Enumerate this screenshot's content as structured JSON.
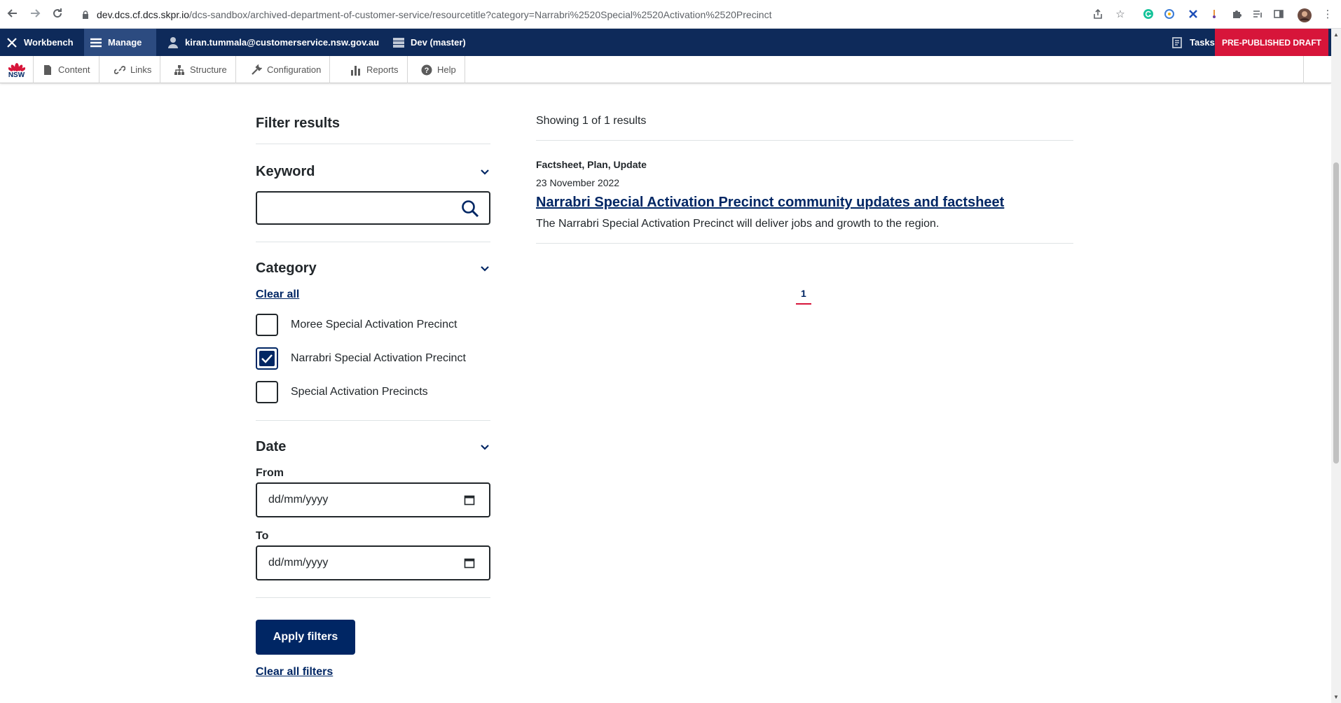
{
  "browser": {
    "url_host": "dev.dcs.cf.dcs.skpr.io",
    "url_path": "/dcs-sandbox/archived-department-of-customer-service/resourcetitle?category=Narrabri%2520Special%2520Activation%2520Precinct"
  },
  "admin_toolbar": {
    "workbench": "Workbench",
    "manage": "Manage",
    "user": "kiran.tummala@customerservice.nsw.gov.au",
    "environment": "Dev (master)",
    "tasks": "Tasks",
    "status": "PRE-PUBLISHED DRAFT"
  },
  "sub_toolbar": {
    "logo": "NSW",
    "items": [
      {
        "label": "Content",
        "icon": "file-icon"
      },
      {
        "label": "Links",
        "icon": "link-icon"
      },
      {
        "label": "Structure",
        "icon": "sitemap-icon"
      },
      {
        "label": "Configuration",
        "icon": "wrench-icon"
      },
      {
        "label": "Reports",
        "icon": "bar-chart-icon"
      },
      {
        "label": "Help",
        "icon": "help-icon"
      }
    ]
  },
  "filters": {
    "heading": "Filter results",
    "keyword": {
      "title": "Keyword",
      "value": ""
    },
    "category": {
      "title": "Category",
      "clear_all": "Clear all",
      "options": [
        {
          "label": "Moree Special Activation Precinct",
          "checked": false
        },
        {
          "label": "Narrabri Special Activation Precinct",
          "checked": true
        },
        {
          "label": "Special Activation Precincts",
          "checked": false
        }
      ]
    },
    "date": {
      "title": "Date",
      "from_label": "From",
      "from_value": "dd/mm/yyyy",
      "to_label": "To",
      "to_value": "dd/mm/yyyy"
    },
    "apply": "Apply filters",
    "clear_all_filters": "Clear all filters"
  },
  "results": {
    "count_text": "Showing 1 of 1 results",
    "items": [
      {
        "type": "Factsheet, Plan, Update",
        "date": "23 November 2022",
        "title": "Narrabri Special Activation Precinct community updates and factsheet",
        "description": "The Narrabri Special Activation Precinct will deliver jobs and growth to the region."
      }
    ],
    "pagination": {
      "current": "1"
    }
  },
  "colors": {
    "brand_navy": "#002664",
    "admin_bar": "#0e2a5a",
    "draft_red": "#d7153a"
  }
}
